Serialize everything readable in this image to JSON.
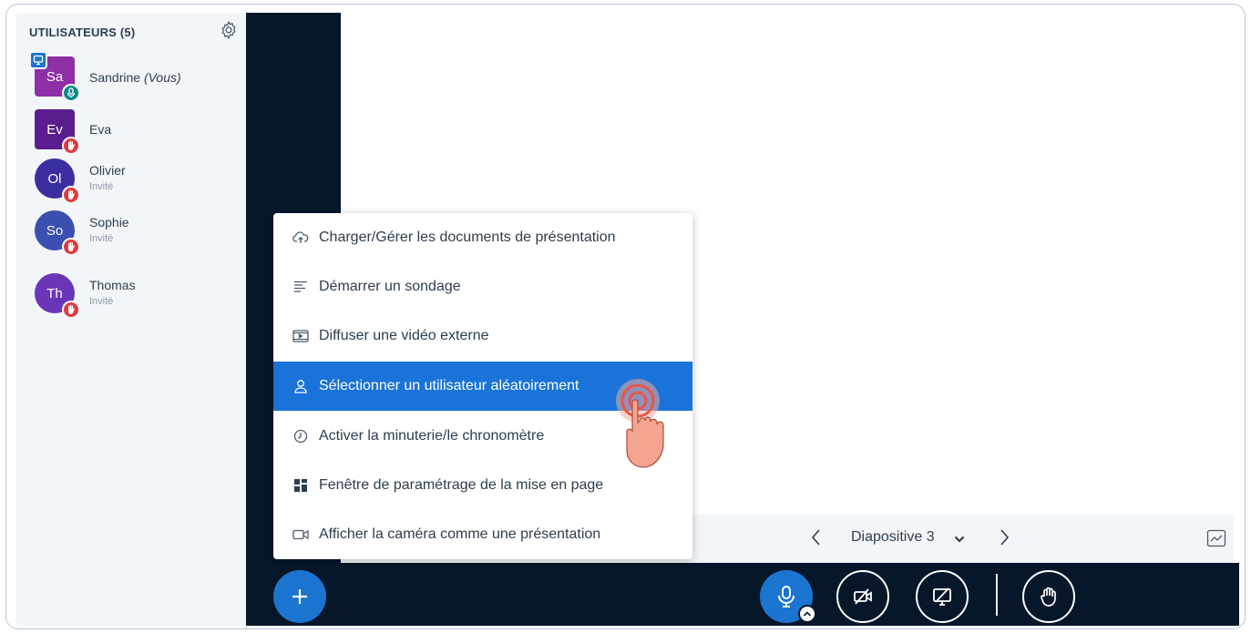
{
  "sidebar": {
    "title": "UTILISATEURS (5)",
    "users": [
      {
        "initials": "Sa",
        "name": "Sandrine",
        "suffix": "(Vous)",
        "role": "",
        "color": "#8e2fa6",
        "shape": "square",
        "badge_color": "#0f8a8a",
        "badge_icon": "mic-icon",
        "presenter": true
      },
      {
        "initials": "Ev",
        "name": "Eva",
        "suffix": "",
        "role": "",
        "color": "#5b1d8e",
        "shape": "square",
        "badge_color": "#e03a3a",
        "badge_icon": "hand-icon",
        "presenter": false
      },
      {
        "initials": "Ol",
        "name": "Olivier",
        "suffix": "",
        "role": "Invité",
        "color": "#3a2fa0",
        "shape": "round",
        "badge_color": "#e03a3a",
        "badge_icon": "hand-icon",
        "presenter": false
      },
      {
        "initials": "So",
        "name": "Sophie",
        "suffix": "",
        "role": "Invité",
        "color": "#3a4fb0",
        "shape": "round",
        "badge_color": "#e03a3a",
        "badge_icon": "hand-icon",
        "presenter": false
      },
      {
        "initials": "Th",
        "name": "Thomas",
        "suffix": "",
        "role": "Invité",
        "color": "#6b35b8",
        "shape": "round",
        "badge_color": "#e03a3a",
        "badge_icon": "hand-icon",
        "presenter": false
      }
    ]
  },
  "menu": {
    "items": [
      {
        "label": "Charger/Gérer les documents de présentation",
        "icon": "cloud-upload-icon",
        "active": false
      },
      {
        "label": "Démarrer un sondage",
        "icon": "poll-list-icon",
        "active": false
      },
      {
        "label": "Diffuser une vidéo externe",
        "icon": "video-play-icon",
        "active": false
      },
      {
        "label": "Sélectionner un utilisateur aléatoirement",
        "icon": "user-icon",
        "active": true
      },
      {
        "label": "Activer la minuterie/le chronomètre",
        "icon": "clock-icon",
        "active": false
      },
      {
        "label": "Fenêtre de paramétrage de la mise en page",
        "icon": "layout-grid-icon",
        "active": false
      },
      {
        "label": "Afficher la caméra comme une présentation",
        "icon": "camera-icon",
        "active": false
      }
    ]
  },
  "presentation": {
    "slide_label": "Diapositive 3"
  },
  "colors": {
    "accent": "#1b75d0",
    "dark": "#06172a",
    "menu_active": "#1a73d8"
  }
}
